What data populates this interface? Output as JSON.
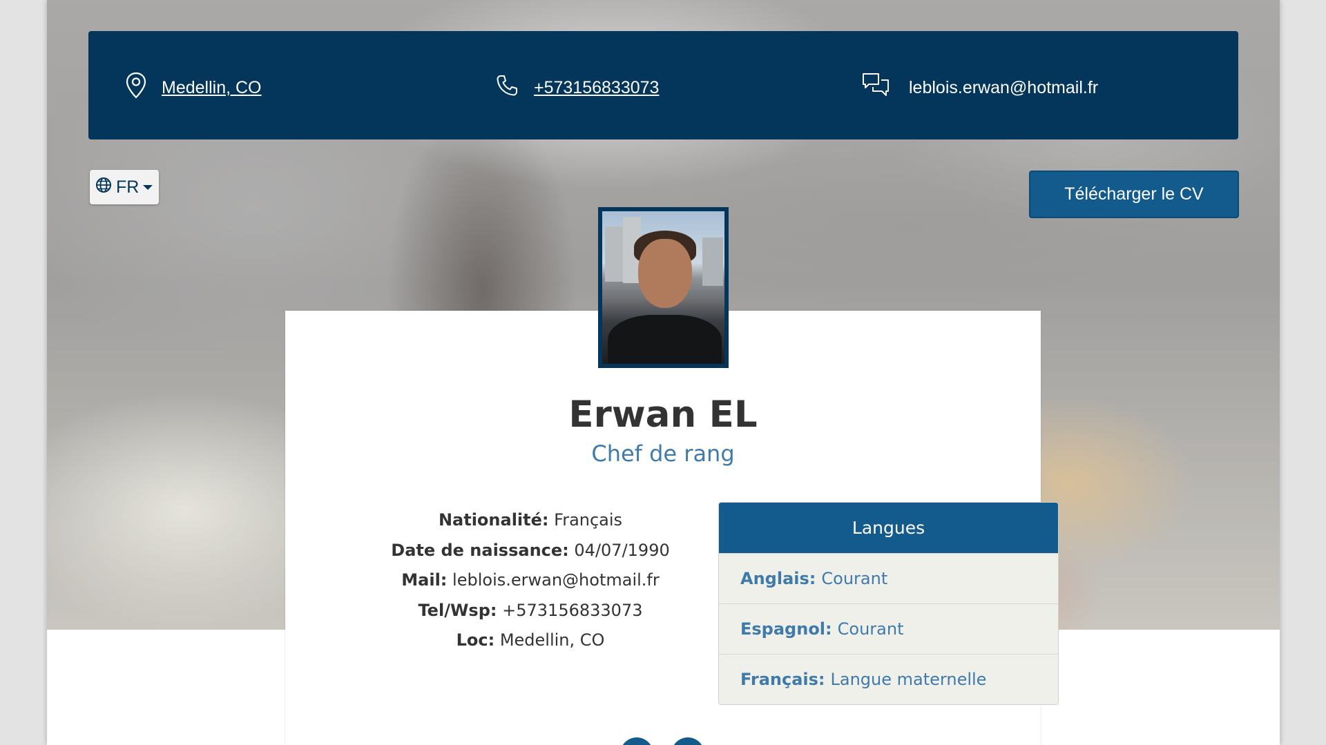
{
  "contact_bar": {
    "location": "Medellin, CO",
    "phone": "+573156833073",
    "email": "leblois.erwan@hotmail.fr",
    "icons": [
      "map-pin-icon",
      "phone-icon",
      "chat-icon"
    ]
  },
  "language_switch": {
    "code": "FR",
    "icon": "globe-icon"
  },
  "download_button": "Télécharger le CV",
  "profile": {
    "name": "Erwan EL",
    "role": "Chef de rang"
  },
  "details": [
    {
      "label": "Nationalité:",
      "value": "Français"
    },
    {
      "label": "Date de naissance:",
      "value": "04/07/1990"
    },
    {
      "label": "Mail:",
      "value": "leblois.erwan@hotmail.fr"
    },
    {
      "label": "Tel/Wsp:",
      "value": "+573156833073"
    },
    {
      "label": "Loc:",
      "value": "Medellin, CO"
    }
  ],
  "languages": {
    "title": "Langues",
    "items": [
      {
        "name": "Anglais:",
        "level": "Courant"
      },
      {
        "name": "Espagnol:",
        "level": "Courant"
      },
      {
        "name": "Français:",
        "level": "Langue maternelle"
      }
    ]
  },
  "colors": {
    "navy": "#04365b",
    "primary_blue": "#135a8d",
    "accent_text": "#3f7aab"
  }
}
